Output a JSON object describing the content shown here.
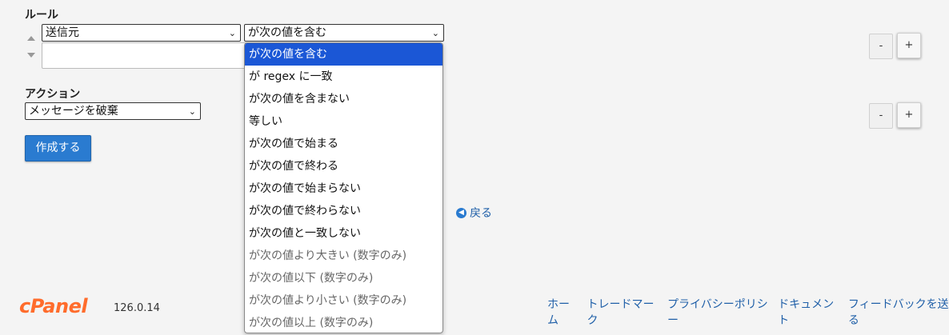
{
  "rules": {
    "label": "ルール",
    "field_select": "送信元",
    "condition_select": "が次の値を含む",
    "condition_options": [
      {
        "label": "が次の値を含む",
        "selected": true,
        "disabled": false
      },
      {
        "label": "が regex に一致",
        "selected": false,
        "disabled": false
      },
      {
        "label": "が次の値を含まない",
        "selected": false,
        "disabled": false
      },
      {
        "label": "等しい",
        "selected": false,
        "disabled": false
      },
      {
        "label": "が次の値で始まる",
        "selected": false,
        "disabled": false
      },
      {
        "label": "が次の値で終わる",
        "selected": false,
        "disabled": false
      },
      {
        "label": "が次の値で始まらない",
        "selected": false,
        "disabled": false
      },
      {
        "label": "が次の値で終わらない",
        "selected": false,
        "disabled": false
      },
      {
        "label": "が次の値と一致しない",
        "selected": false,
        "disabled": false
      },
      {
        "label": "が次の値より大きい (数字のみ)",
        "selected": false,
        "disabled": true
      },
      {
        "label": "が次の値以下 (数字のみ)",
        "selected": false,
        "disabled": true
      },
      {
        "label": "が次の値より小さい (数字のみ)",
        "selected": false,
        "disabled": true
      },
      {
        "label": "が次の値以上 (数字のみ)",
        "selected": false,
        "disabled": true
      }
    ],
    "remove_label": "-",
    "add_label": "+"
  },
  "actions": {
    "label": "アクション",
    "action_select": "メッセージを破棄",
    "remove_label": "-",
    "add_label": "+"
  },
  "create_button": "作成する",
  "back_link": "戻る",
  "footer": {
    "logo": "cPanel",
    "version": "126.0.14",
    "links": [
      "ホーム",
      "トレードマーク",
      "プライバシーポリシー",
      "ドキュメント",
      "フィードバックを送る"
    ]
  },
  "colors": {
    "accent": "#2a7bd0",
    "link": "#1f5fa8",
    "logo": "#ff6c2c",
    "selected_option": "#1b57d6"
  }
}
